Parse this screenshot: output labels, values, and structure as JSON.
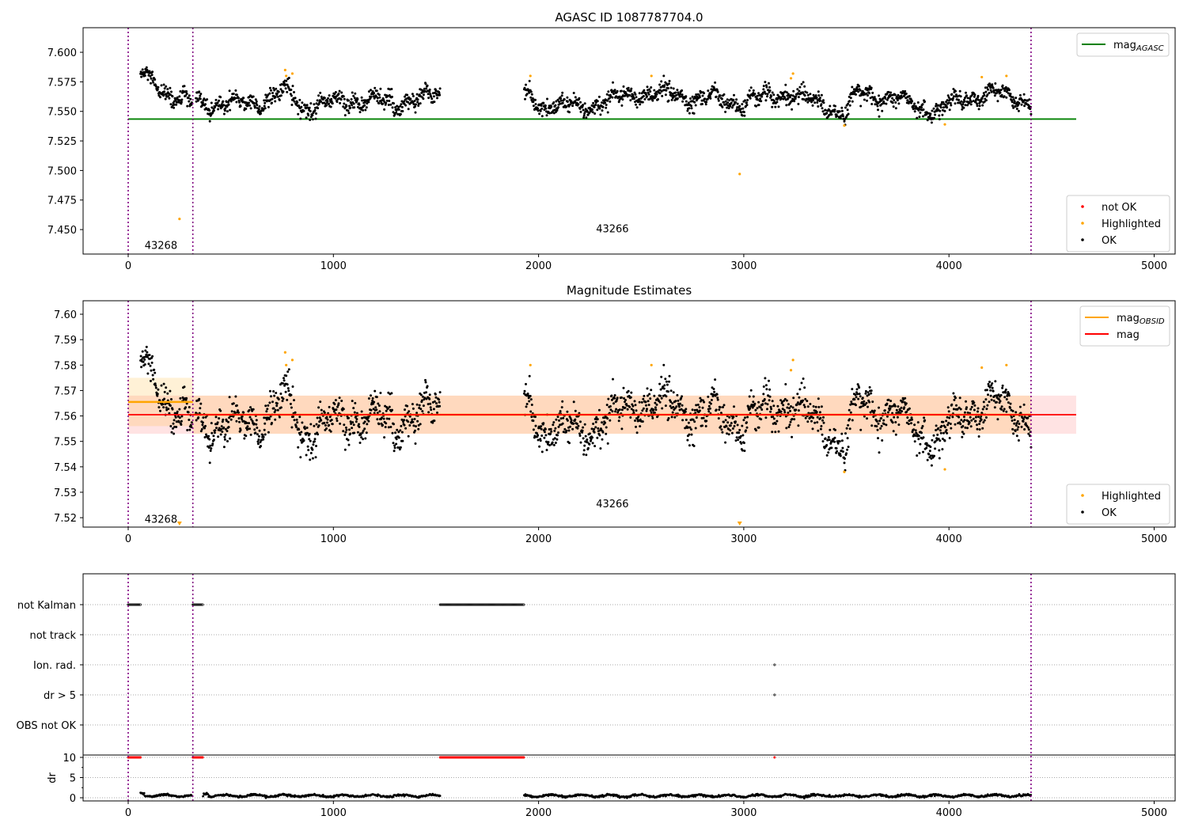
{
  "chart_data": [
    {
      "type": "scatter",
      "title": "AGASC ID 1087787704.0",
      "xlim": [
        -220,
        5100
      ],
      "ylim": [
        7.4293,
        7.6208
      ],
      "xticks": [
        0,
        1000,
        2000,
        3000,
        4000,
        5000
      ],
      "yticks": [
        "7.450",
        "7.475",
        "7.500",
        "7.525",
        "7.550",
        "7.575",
        "7.600"
      ],
      "lines": [
        {
          "name": "mag_AGASC",
          "label": "mag",
          "sub": "AGASC",
          "value": 7.5435,
          "x": [
            0,
            4620
          ],
          "color": "#008000"
        }
      ],
      "legend_bottom": [
        {
          "label": "not OK",
          "color": "#ff0000"
        },
        {
          "label": "Highlighted",
          "color": "#ffa500"
        },
        {
          "label": "OK",
          "color": "#000000"
        }
      ],
      "annotations": [
        {
          "text": "43268",
          "x": 80,
          "y": 7.437
        },
        {
          "text": "43266",
          "x": 2280,
          "y": 7.451
        }
      ]
    },
    {
      "type": "scatter",
      "title": "Magnitude Estimates",
      "xlim": [
        -220,
        5100
      ],
      "ylim": [
        7.5163,
        7.6053
      ],
      "xticks": [
        0,
        1000,
        2000,
        3000,
        4000,
        5000
      ],
      "yticks": [
        "7.52",
        "7.53",
        "7.54",
        "7.55",
        "7.56",
        "7.57",
        "7.58",
        "7.59",
        "7.60"
      ],
      "mag": {
        "label": "mag",
        "value": 7.5605,
        "band": [
          7.553,
          7.568
        ],
        "x": [
          0,
          4620
        ],
        "color": "#ff0000"
      },
      "mag_obsid": {
        "label": "mag",
        "sub": "OBSID",
        "color": "#ffa500",
        "segments": [
          {
            "x": [
              0,
              315
            ],
            "value": 7.5655,
            "band": [
              7.556,
              7.575
            ]
          },
          {
            "x": [
              315,
              4400
            ],
            "value": 7.5605,
            "band": [
              7.553,
              7.568
            ]
          }
        ]
      },
      "legend_bottom": [
        {
          "label": "Highlighted",
          "color": "#ffa500"
        },
        {
          "label": "OK",
          "color": "#000000"
        }
      ],
      "annotations": [
        {
          "text": "43268",
          "x": 80,
          "y": 7.5195
        },
        {
          "text": "43266",
          "x": 2280,
          "y": 7.5257
        }
      ]
    },
    {
      "type": "scatter",
      "flags": [
        "not Kalman",
        "not track",
        "Ion. rad.",
        "dr > 5",
        "OBS not OK"
      ],
      "flag_points": {
        "not Kalman": [
          [
            0,
            60
          ],
          [
            315,
            365
          ],
          [
            1520,
            1930
          ]
        ],
        "Ion. rad.": [
          [
            3150,
            3150
          ]
        ],
        "dr > 5": [
          [
            3150,
            3150
          ]
        ]
      },
      "dr_ylabel": "dr",
      "dr_yticks": [
        0,
        5,
        10
      ],
      "dr_ylim": [
        -0.8,
        10.8
      ],
      "dr_clipped_value": 10,
      "dr_clipped_intervals": [
        [
          0,
          60
        ],
        [
          315,
          365
        ],
        [
          1520,
          1930
        ],
        [
          3150,
          3150
        ]
      ],
      "dr_typical": 0.5,
      "xticks": [
        0,
        1000,
        2000,
        3000,
        4000,
        5000
      ]
    }
  ],
  "obsid_boundaries": [
    0,
    315,
    4400
  ],
  "segments": [
    {
      "obsid": "43268",
      "knots": [
        [
          60,
          7.581
        ],
        [
          150,
          7.572
        ],
        [
          250,
          7.558
        ],
        [
          310,
          7.556
        ]
      ]
    },
    {
      "obsid": "43266",
      "knots": [
        [
          330,
          7.557
        ],
        [
          500,
          7.556
        ],
        [
          700,
          7.56
        ],
        [
          780,
          7.568
        ],
        [
          850,
          7.552
        ],
        [
          1000,
          7.558
        ],
        [
          1200,
          7.56
        ],
        [
          1300,
          7.556
        ],
        [
          1520,
          7.565
        ]
      ]
    },
    {
      "obsid": "43266",
      "knots": [
        [
          1930,
          7.565
        ],
        [
          2000,
          7.556
        ],
        [
          2200,
          7.553
        ],
        [
          2500,
          7.566
        ],
        [
          2800,
          7.561
        ],
        [
          3000,
          7.557
        ],
        [
          3200,
          7.565
        ],
        [
          3400,
          7.556
        ],
        [
          3500,
          7.548
        ],
        [
          3550,
          7.566
        ],
        [
          3700,
          7.562
        ],
        [
          3950,
          7.55
        ],
        [
          4000,
          7.556
        ],
        [
          4200,
          7.566
        ],
        [
          4400,
          7.558
        ]
      ]
    }
  ],
  "highlighted": [
    [
      765,
      7.585
    ],
    [
      770,
      7.58
    ],
    [
      800,
      7.582
    ],
    [
      1960,
      7.58
    ],
    [
      2550,
      7.58
    ],
    [
      3230,
      7.578
    ],
    [
      3240,
      7.582
    ],
    [
      4160,
      7.579
    ],
    [
      4280,
      7.58
    ],
    [
      3490,
      7.538
    ],
    [
      3980,
      7.539
    ],
    [
      250,
      7.459
    ],
    [
      2980,
      7.497
    ]
  ]
}
